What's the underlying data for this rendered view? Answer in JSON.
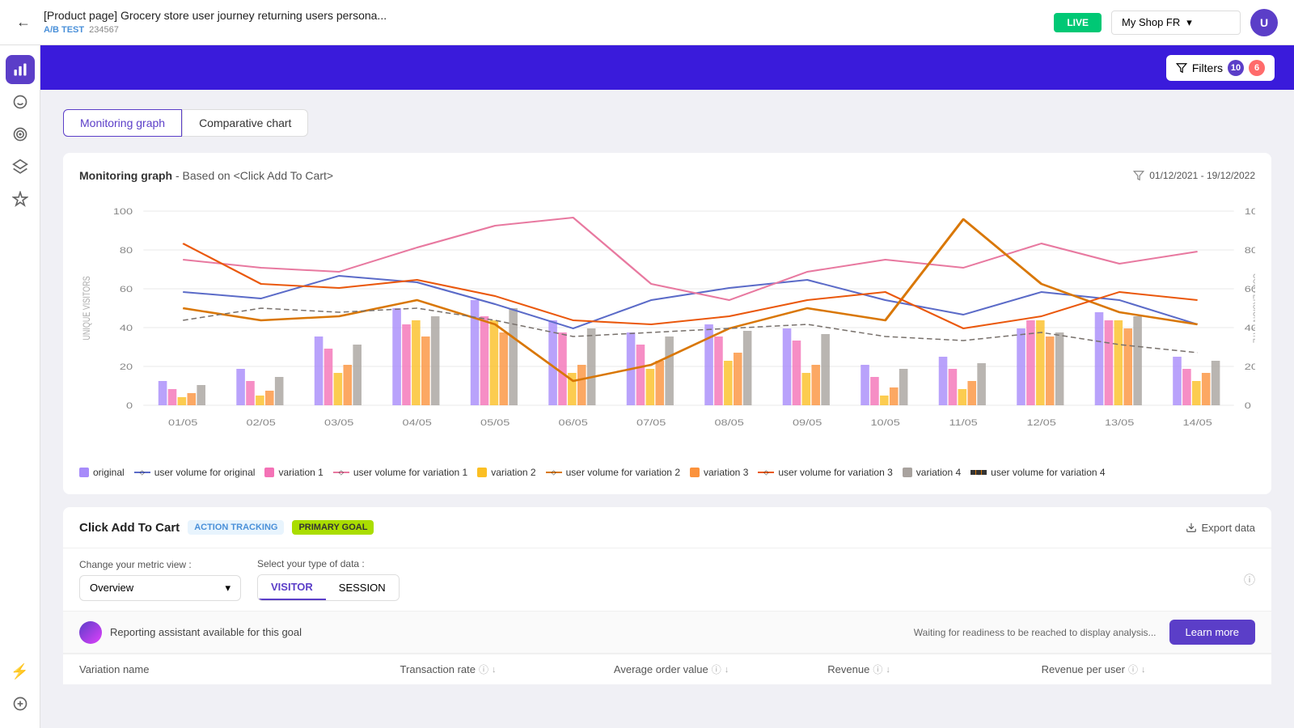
{
  "topbar": {
    "back_icon": "←",
    "title": "[Product page] Grocery store user journey returning users persona...",
    "badge_label": "A/B TEST",
    "badge_id": "234567",
    "live_label": "LIVE",
    "shop_label": "My Shop FR",
    "avatar_initials": "U"
  },
  "filters": {
    "label": "Filters",
    "count1": "10",
    "count2": "6"
  },
  "tabs": [
    {
      "id": "monitoring",
      "label": "Monitoring graph",
      "active": true
    },
    {
      "id": "comparative",
      "label": "Comparative chart",
      "active": false
    }
  ],
  "chart": {
    "title": "Monitoring graph",
    "subtitle": "  -  Based on <Click Add To Cart>",
    "date_range": "01/12/2021 - 19/12/2022",
    "y_left_label": "UNIQUE VISITORS",
    "y_right_label": "CONVERSION RATE",
    "x_labels": [
      "01/05",
      "02/05",
      "03/05",
      "04/05",
      "05/05",
      "06/05",
      "07/05",
      "08/05",
      "09/05",
      "10/05",
      "11/05",
      "12/05",
      "13/05",
      "14/05"
    ],
    "y_ticks": [
      "0",
      "20",
      "40",
      "60",
      "80",
      "100"
    ]
  },
  "legend": [
    {
      "id": "original",
      "label": "original",
      "color": "#a78bfa",
      "type": "bar"
    },
    {
      "id": "user-vol-orig",
      "label": "user volume for original",
      "color": "#5b3ec8",
      "type": "line"
    },
    {
      "id": "variation1",
      "label": "variation 1",
      "color": "#f472b6",
      "type": "bar"
    },
    {
      "id": "user-vol-v1",
      "label": "user volume for variation 1",
      "color": "#f472b6",
      "type": "line"
    },
    {
      "id": "variation2",
      "label": "variation 2",
      "color": "#fbbf24",
      "type": "bar"
    },
    {
      "id": "user-vol-v2",
      "label": "user volume for variation 2",
      "color": "#f59e0b",
      "type": "line"
    },
    {
      "id": "variation3",
      "label": "variation 3",
      "color": "#fb923c",
      "type": "bar"
    },
    {
      "id": "user-vol-v3",
      "label": "user volume for variation 3",
      "color": "#ea580c",
      "type": "line"
    },
    {
      "id": "variation4",
      "label": "variation 4",
      "color": "#a8a29e",
      "type": "bar"
    },
    {
      "id": "user-vol-v4",
      "label": "user volume for variation 4",
      "color": "#fbbf24",
      "type": "line"
    }
  ],
  "goal": {
    "title": "Click Add To Cart",
    "badge_action": "ACTION TRACKING",
    "badge_primary": "PRIMARY GOAL",
    "export_label": "Export data",
    "metric_label": "Change your metric view :",
    "metric_value": "Overview",
    "data_type_label": "Select your type of data :",
    "visitor_label": "VISITOR",
    "session_label": "SESSION",
    "assistant_text": "Reporting assistant available for this goal",
    "waiting_text": "Waiting for readiness to be reached to display analysis...",
    "learn_btn": "Learn more"
  },
  "table": {
    "columns": [
      {
        "label": "Variation name"
      },
      {
        "label": "Transaction rate",
        "info": true,
        "sort": true
      },
      {
        "label": "Average order value",
        "info": true,
        "sort": true
      },
      {
        "label": "Revenue",
        "info": true,
        "sort": true
      },
      {
        "label": "Revenue per user",
        "info": true,
        "sort": true
      }
    ]
  },
  "sidebar": {
    "icons": [
      {
        "id": "stats",
        "symbol": "📊",
        "active": true
      },
      {
        "id": "smile",
        "symbol": "😊",
        "active": false
      },
      {
        "id": "target",
        "symbol": "🎯",
        "active": false
      },
      {
        "id": "layers",
        "symbol": "⊕",
        "active": false
      },
      {
        "id": "sparkle",
        "symbol": "✦",
        "active": false
      }
    ],
    "bottom_icons": [
      {
        "id": "bolt",
        "symbol": "⚡",
        "active": false
      },
      {
        "id": "add",
        "symbol": "⊕",
        "active": false
      }
    ]
  }
}
